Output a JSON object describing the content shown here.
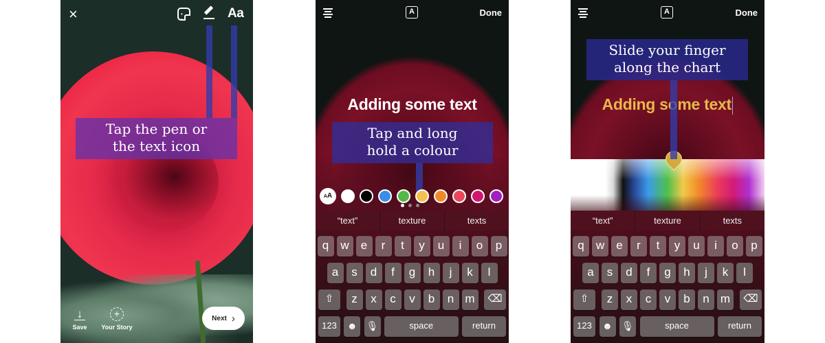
{
  "panels": [
    {
      "id": "story-camera",
      "top_bar": {
        "close_icon": "×",
        "sticker_icon": "sticker-icon",
        "pen_icon": "pen-icon",
        "text_icon_label": "Aa"
      },
      "callout": [
        "Tap the pen or",
        "the text icon"
      ],
      "bottom": {
        "save_label": "Save",
        "save_icon": "↓",
        "story_label": "Your Story",
        "story_icon": "+",
        "next_label": "Next",
        "next_icon": "›"
      }
    },
    {
      "id": "text-editor",
      "top_bar": {
        "style_icon_label": "A",
        "done_label": "Done"
      },
      "typed_text": "Adding some text",
      "callout": [
        "Tap and long",
        "hold a colour"
      ],
      "aa_label": "A",
      "aa_small_label": "A",
      "swatches": [
        "#ffffff",
        "#000000",
        "#3b8ee8",
        "#54b848",
        "#f5c04e",
        "#f08a24",
        "#e8485a",
        "#d11672",
        "#a020c0"
      ],
      "page_dots": {
        "count": 3,
        "active": 0
      },
      "suggestions": [
        "“text”",
        "texture",
        "texts"
      ]
    },
    {
      "id": "color-picker",
      "top_bar": {
        "style_icon_label": "A",
        "done_label": "Done"
      },
      "typed_text": "Adding some text",
      "typed_color": "#e8b84a",
      "callout": [
        "Slide your finger",
        "along the chart"
      ],
      "suggestions": [
        "“text”",
        "texture",
        "texts"
      ]
    }
  ],
  "keyboard": {
    "row1": [
      "q",
      "w",
      "e",
      "r",
      "t",
      "y",
      "u",
      "i",
      "o",
      "p"
    ],
    "row2": [
      "a",
      "s",
      "d",
      "f",
      "g",
      "h",
      "j",
      "k",
      "l"
    ],
    "row3": [
      "z",
      "x",
      "c",
      "v",
      "b",
      "n",
      "m"
    ],
    "shift_icon": "⇧",
    "delete_icon": "⌫",
    "numbers_label": "123",
    "emoji_icon": "☻",
    "mic_icon": "🎙",
    "space_label": "space",
    "return_label": "return"
  },
  "colors": {
    "callout_purple": "#6432aa",
    "callout_blue": "#2d2d96",
    "picker_pin": "#d4aa3e"
  }
}
